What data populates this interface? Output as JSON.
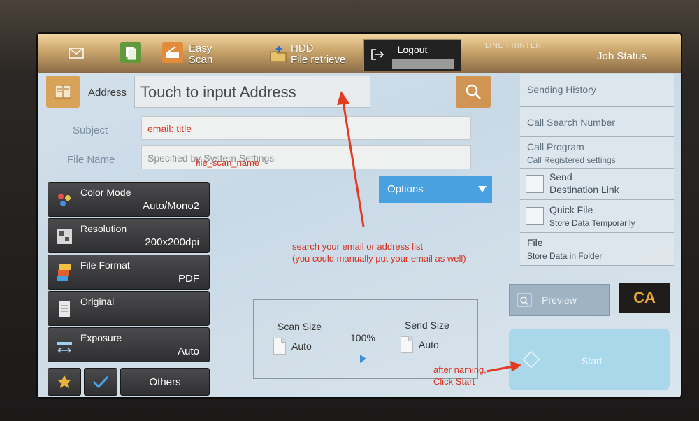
{
  "topbar": {
    "easy_scan_line1": "Easy",
    "easy_scan_line2": "Scan",
    "hdd_line1": "HDD",
    "hdd_line2": "File retrieve",
    "logout_label": "Logout",
    "line_printer_label": "LINE   PRINTER",
    "job_status_label": "Job Status"
  },
  "address": {
    "label": "Address",
    "placeholder": "Touch to input Address"
  },
  "subject": {
    "label": "Subject",
    "value": "email: title"
  },
  "file_name": {
    "label": "File Name",
    "placeholder": "Specified by System Settings",
    "value": "file_scan_name"
  },
  "options_label": "Options",
  "settings": [
    {
      "title": "Color Mode",
      "value": "Auto/Mono2"
    },
    {
      "title": "Resolution",
      "value": "200x200dpi"
    },
    {
      "title": "File Format",
      "value": "PDF"
    },
    {
      "title": "Original",
      "value": ""
    },
    {
      "title": "Exposure",
      "value": "Auto"
    }
  ],
  "bottom_buttons": {
    "others_label": "Others"
  },
  "annotations": {
    "search_note_line1": "search your email or address list",
    "search_note_line2": "(you could manually put your email as well)",
    "start_note_line1": "after naming,",
    "start_note_line2": "Click Start"
  },
  "scan_panel": {
    "scan_size_label": "Scan Size",
    "scan_size_value": "Auto",
    "ratio": "100%",
    "send_size_label": "Send Size",
    "send_size_value": "Auto"
  },
  "right_panel": {
    "sending_history": "Sending History",
    "call_search_number": "Call Search Number",
    "call_program": "Call Program",
    "call_program_sub": "Call Registered settings",
    "send_dest_line1": "Send",
    "send_dest_line2": "Destination Link",
    "quick_file": "Quick File",
    "quick_file_sub": "Store Data Temporarily",
    "file": "File",
    "file_sub": "Store Data in Folder"
  },
  "preview_label": "Preview",
  "ca_label": "CA",
  "start_label": "Start",
  "colors": {
    "accent_orange": "#d09552",
    "options_blue": "#4aa1e0",
    "annotation_red": "#d9311f",
    "ca_text": "#e7a934"
  }
}
